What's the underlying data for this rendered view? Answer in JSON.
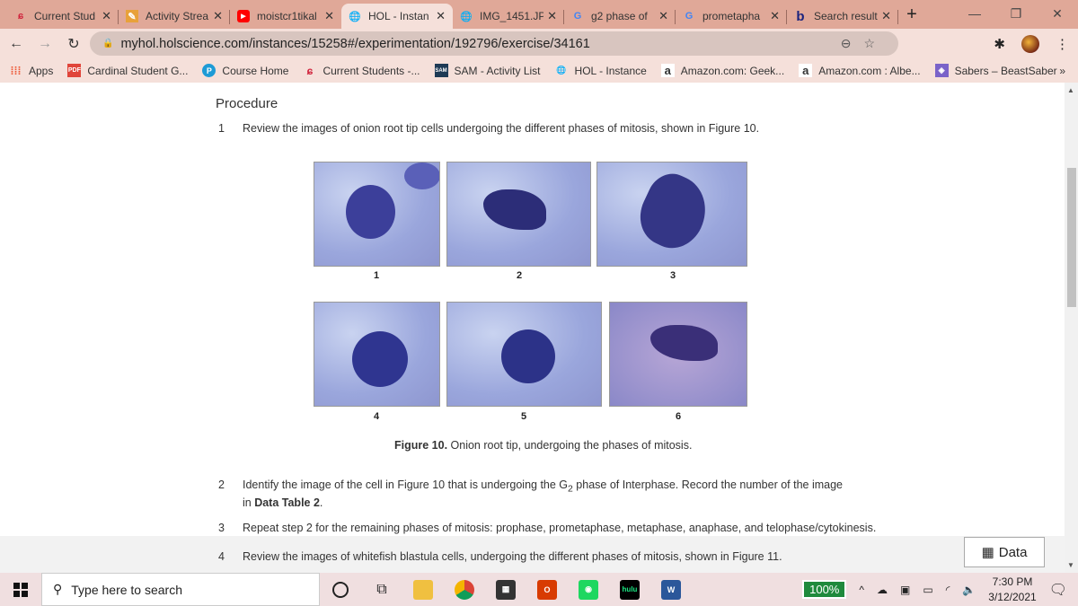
{
  "browser": {
    "tabs": [
      {
        "title": "Current Stud",
        "icon": "cardinal-logo-icon"
      },
      {
        "title": "Activity Strea",
        "icon": "pencil-icon"
      },
      {
        "title": "moistcr1tikal",
        "icon": "youtube-icon"
      },
      {
        "title": "HOL - Instan",
        "icon": "globe-icon",
        "active": true
      },
      {
        "title": "IMG_1451.JP",
        "icon": "globe-icon"
      },
      {
        "title": "g2 phase of",
        "icon": "google-icon"
      },
      {
        "title": "prometapha",
        "icon": "google-icon"
      },
      {
        "title": "Search result",
        "icon": "bing-icon"
      }
    ],
    "url": "myhol.holscience.com/instances/15258#/experimentation/192796/exercise/34161",
    "bookmarks": [
      {
        "label": "Apps",
        "icon": "apps-grid-icon"
      },
      {
        "label": "Cardinal Student G...",
        "icon": "pdf-icon"
      },
      {
        "label": "Course Home",
        "icon": "pearson-icon"
      },
      {
        "label": "Current Students -...",
        "icon": "cardinal-logo-icon"
      },
      {
        "label": "SAM - Activity List",
        "icon": "sam-icon"
      },
      {
        "label": "HOL - Instance",
        "icon": "globe-icon"
      },
      {
        "label": "Amazon.com: Geek...",
        "icon": "amazon-icon"
      },
      {
        "label": "Amazon.com : Albe...",
        "icon": "amazon-icon"
      },
      {
        "label": "Sabers – BeastSaber",
        "icon": "beastsaber-icon"
      }
    ],
    "bookmarks_more": "»"
  },
  "page": {
    "heading": "Procedure",
    "step1": {
      "n": "1",
      "text": "Review the images of onion root tip cells undergoing the different phases of mitosis, shown in Figure 10."
    },
    "figure_labels": [
      "1",
      "2",
      "3",
      "4",
      "5",
      "6"
    ],
    "caption_bold": "Figure 10.",
    "caption": " Onion root tip, undergoing the phases of mitosis.",
    "step2": {
      "n": "2",
      "pre": "Identify the image of the cell in Figure 10 that is undergoing the G",
      "sub": "2",
      "post": " phase of Interphase. Record the number of the image in ",
      "bold": "Data Table 2",
      "end": "."
    },
    "step3": {
      "n": "3",
      "text": "Repeat step 2 for the remaining phases of mitosis: prophase, prometaphase, metaphase, anaphase, and telophase/cytokinesis."
    },
    "step4": {
      "n": "4",
      "text": "Review the images of whitefish blastula cells, undergoing the different phases of mitosis, shown in Figure 11."
    },
    "data_button": "Data"
  },
  "taskbar": {
    "search_placeholder": "Type here to search",
    "battery": "100%",
    "time": "7:30 PM",
    "date": "3/12/2021"
  }
}
